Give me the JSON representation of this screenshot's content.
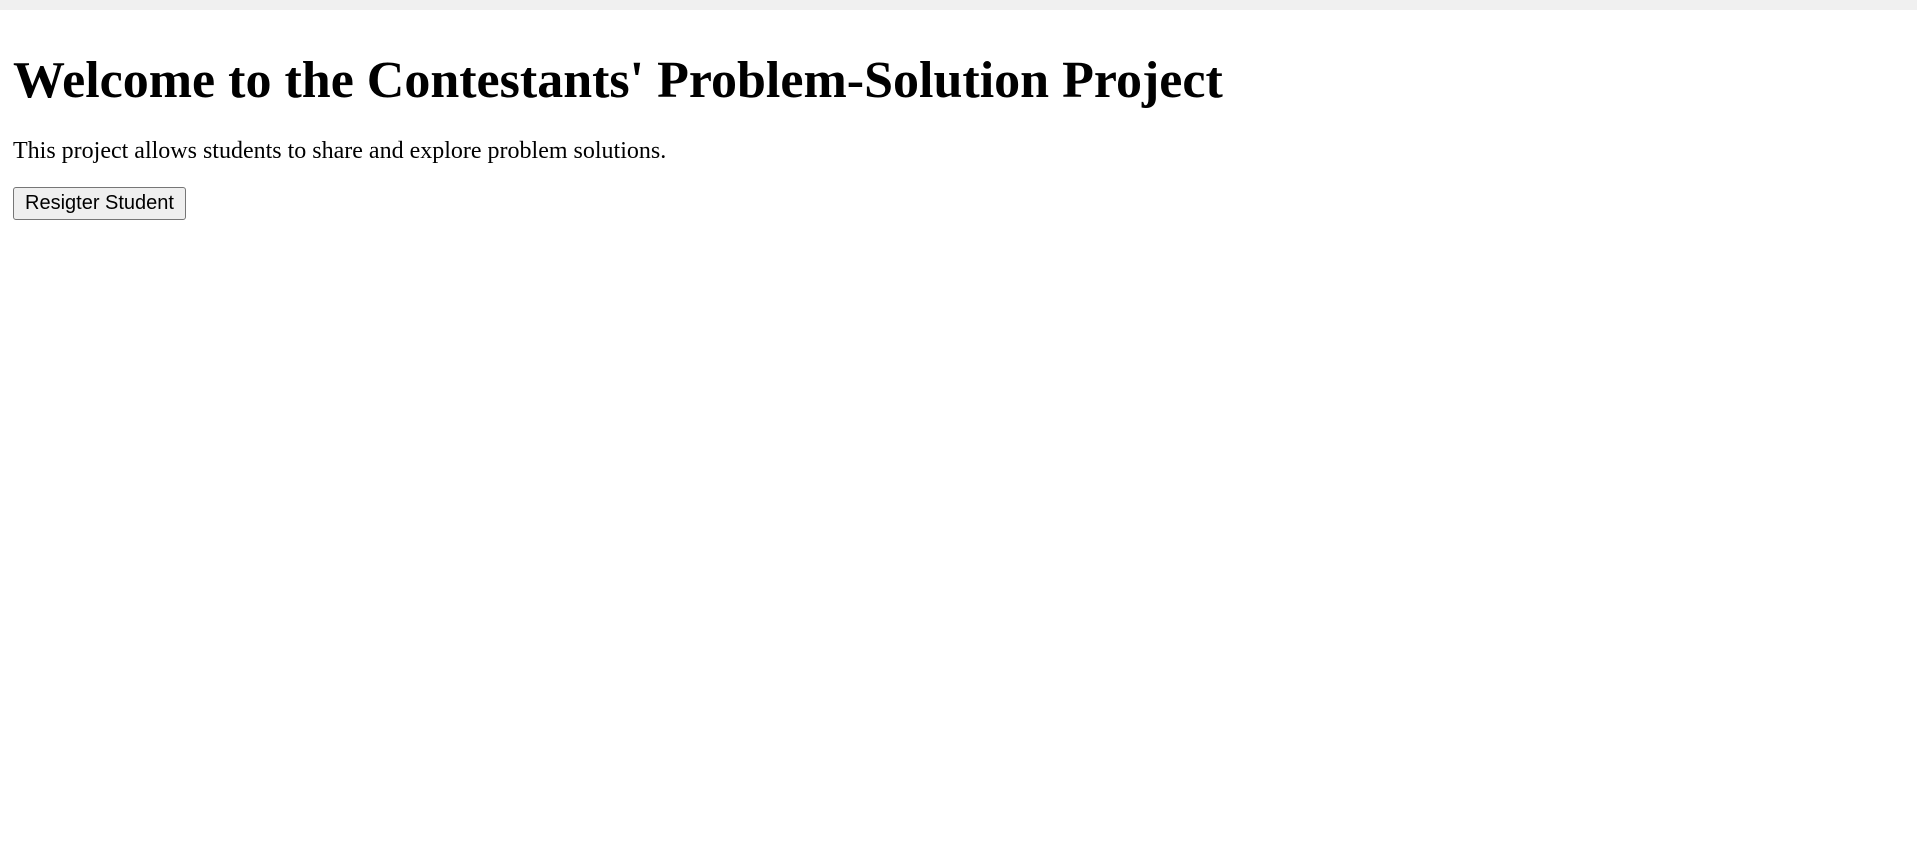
{
  "page": {
    "title": "Welcome to the Contestants' Problem-Solution Project",
    "description": "This project allows students to share and explore problem solutions.",
    "register_button_label": "Resigter Student"
  },
  "colors": {
    "background": "#ffffff",
    "top_strip": "#f0f0f0",
    "text": "#000000",
    "button_background": "#efefef",
    "button_border": "#767676"
  }
}
